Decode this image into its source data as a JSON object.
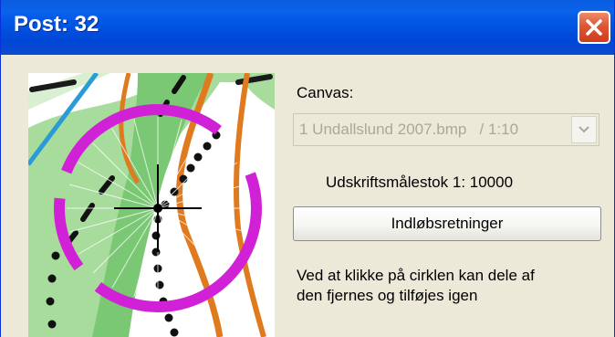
{
  "window": {
    "title": "Post: 32"
  },
  "canvas": {
    "label": "Canvas:",
    "selected": "1 Undallslund 2007.bmp   / 1:10"
  },
  "scale": {
    "text": "Udskriftsmålestok  1: 10000"
  },
  "buttons": {
    "entry_directions": "Indløbsretninger"
  },
  "info": {
    "line1": "Ved at klikke på cirklen kan dele af",
    "line2": "den fjernes og tilføjes igen"
  },
  "colors": {
    "titlebar": "#0055e5",
    "map_green": "#a3d89a",
    "map_dark_green": "#7bc874",
    "course_magenta": "#d021d6",
    "path_orange": "#e07a1e",
    "water_blue": "#2a9bd6"
  }
}
